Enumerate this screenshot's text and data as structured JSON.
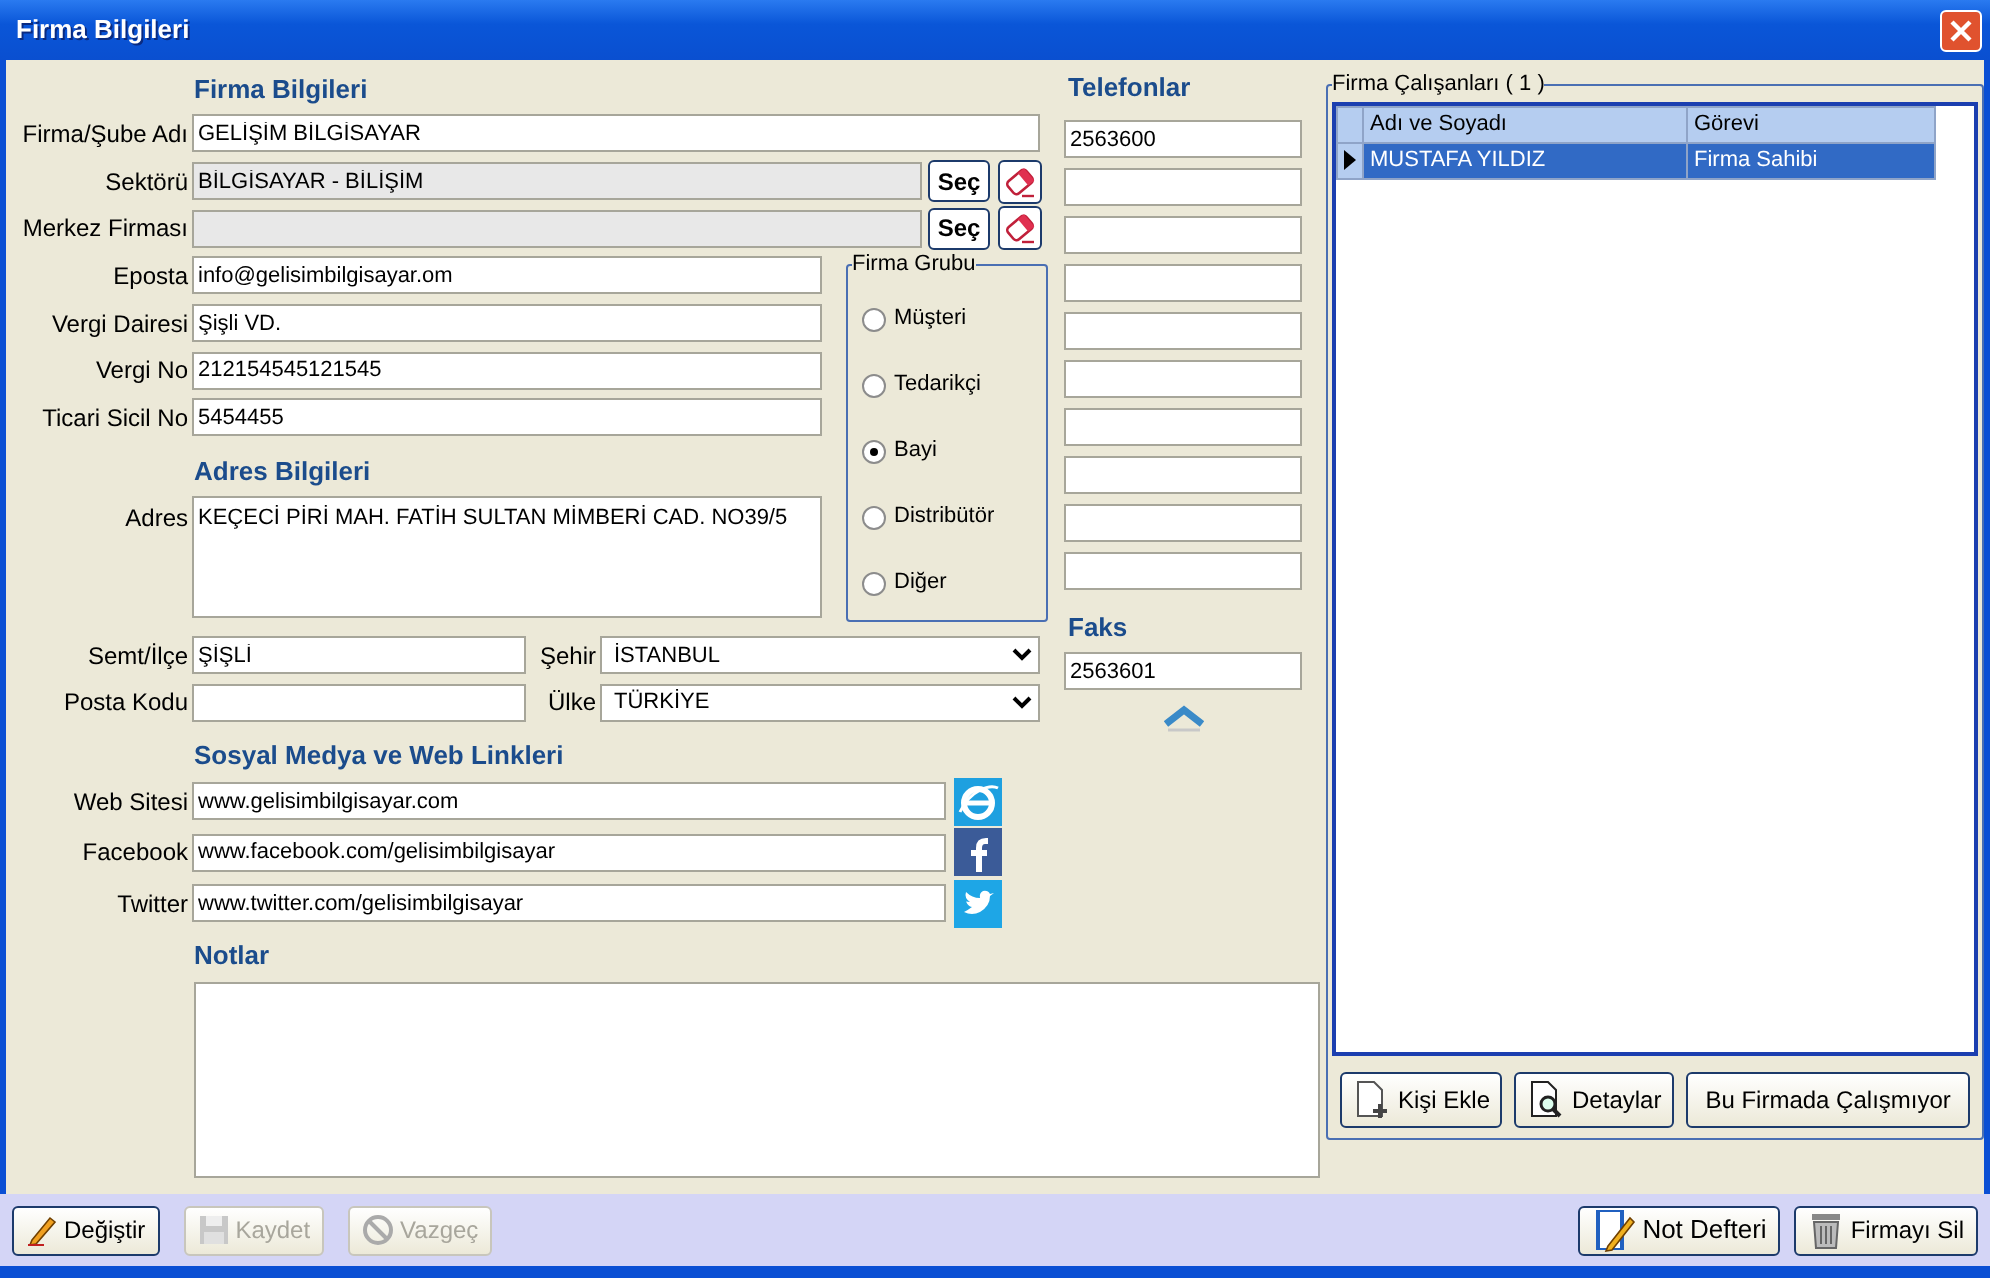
{
  "window": {
    "title": "Firma Bilgileri"
  },
  "company": {
    "heading": "Firma Bilgileri",
    "name": {
      "label": "Firma/Şube Adı",
      "value": "GELİŞİM BİLGİSAYAR"
    },
    "pickers": [
      {
        "label": "Sektörü",
        "value": "BİLGİSAYAR - BİLİŞİM",
        "button": "Seç"
      },
      {
        "label": "Merkez Firması",
        "button": "Seç"
      }
    ],
    "fields": [
      {
        "label": "Eposta",
        "value": "info@gelisimbilgisayar.om"
      },
      {
        "label": "Vergi Dairesi",
        "value": "Şişli VD."
      },
      {
        "label": "Vergi No",
        "value": "212154545121545"
      },
      {
        "label": "Ticari Sicil No",
        "value": "5454455"
      }
    ]
  },
  "group": {
    "title": "Firma Grubu",
    "options": [
      {
        "label": "Müşteri",
        "selected": false
      },
      {
        "label": "Tedarikçi",
        "selected": false
      },
      {
        "label": "Bayi",
        "selected": true
      },
      {
        "label": "Distribütör",
        "selected": false
      },
      {
        "label": "Diğer",
        "selected": false
      }
    ]
  },
  "address": {
    "heading": "Adres Bilgileri",
    "address": {
      "label": "Adres",
      "value": "KEÇECİ PİRİ MAH. FATİH SULTAN MİMBERİ CAD. NO39/5"
    },
    "district": {
      "label": "Semt/İlçe",
      "value": "ŞİŞLİ"
    },
    "city": {
      "label": "Şehir",
      "value": "İSTANBUL"
    },
    "postal": {
      "label": "Posta Kodu"
    },
    "country": {
      "label": "Ülke",
      "value": "TÜRKİYE"
    }
  },
  "social": {
    "heading": "Sosyal Medya ve Web Linkleri",
    "links": [
      {
        "label": "Web Sitesi",
        "value": "www.gelisimbilgisayar.com",
        "kind": "web"
      },
      {
        "label": "Facebook",
        "value": "www.facebook.com/gelisimbilgisayar",
        "kind": "facebook"
      },
      {
        "label": "Twitter",
        "value": "www.twitter.com/gelisimbilgisayar",
        "kind": "twitter"
      }
    ]
  },
  "notes": {
    "heading": "Notlar"
  },
  "phones": {
    "heading": "Telefonlar",
    "fields": [
      {
        "value": "2563600"
      }
    ]
  },
  "fax": {
    "heading": "Faks",
    "value": "2563601"
  },
  "employees": {
    "title": "Firma Çalışanları ( 1 )",
    "columns": [
      "Adı ve Soyadı",
      "Görevi"
    ],
    "rows": [
      {
        "cells": [
          "MUSTAFA YILDIZ",
          "Firma Sahibi"
        ],
        "selected": true
      }
    ],
    "buttons": [
      {
        "label": "Kişi Ekle",
        "kind": "add"
      },
      {
        "label": "Detaylar",
        "kind": "details"
      },
      {
        "label": "Bu Firmada Çalışmıyor",
        "kind": "plain"
      }
    ]
  },
  "toolbar": {
    "left": [
      {
        "label": "Değiştir",
        "kind": "edit",
        "disabled": false
      },
      {
        "label": "Kaydet",
        "kind": "save",
        "disabled": true
      },
      {
        "label": "Vazgeç",
        "kind": "cancel",
        "disabled": true
      }
    ],
    "right": [
      {
        "label": "Not Defteri",
        "kind": "notebook",
        "disabled": false
      },
      {
        "label": "Firmayı Sil",
        "kind": "trash",
        "disabled": false
      }
    ]
  }
}
